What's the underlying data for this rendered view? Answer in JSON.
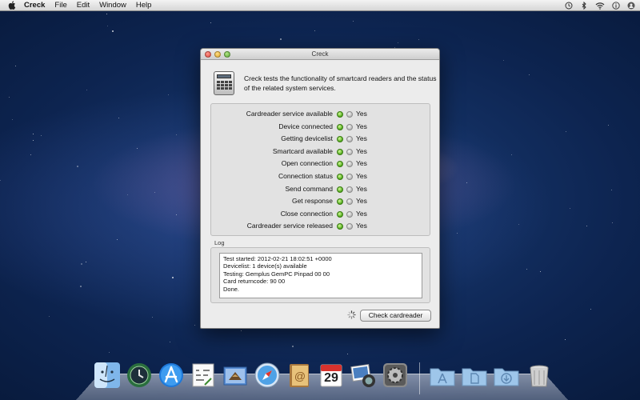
{
  "menubar": {
    "app_name": "Creck",
    "items": [
      "File",
      "Edit",
      "Window",
      "Help"
    ],
    "status_icons": [
      "time-machine-icon",
      "bluetooth-icon",
      "wifi-icon",
      "info-icon",
      "fast-user-switch-icon"
    ]
  },
  "window": {
    "title": "Creck",
    "description": "Creck tests the functionality of smartcard readers and the status of the related system services.",
    "checks": [
      {
        "label": "Cardreader service available",
        "value": "Yes",
        "status": "ok"
      },
      {
        "label": "Device connected",
        "value": "Yes",
        "status": "ok"
      },
      {
        "label": "Getting devicelist",
        "value": "Yes",
        "status": "ok"
      },
      {
        "label": "Smartcard available",
        "value": "Yes",
        "status": "ok"
      },
      {
        "label": "Open connection",
        "value": "Yes",
        "status": "ok"
      },
      {
        "label": "Connection status",
        "value": "Yes",
        "status": "ok"
      },
      {
        "label": "Send command",
        "value": "Yes",
        "status": "ok"
      },
      {
        "label": "Get response",
        "value": "Yes",
        "status": "ok"
      },
      {
        "label": "Close connection",
        "value": "Yes",
        "status": "ok"
      },
      {
        "label": "Cardreader service released",
        "value": "Yes",
        "status": "ok"
      }
    ],
    "log_label": "Log",
    "log_lines": [
      "Test started: 2012-02-21 18:02:51 +0000",
      "Devicelist: 1 device(s) available",
      "Testing: Gemplus GemPC Pinpad 00 00",
      "Card returncode: 90 00",
      "Done."
    ],
    "button_label": "Check cardreader"
  },
  "dock": {
    "apps": [
      "finder-icon",
      "time-machine-icon",
      "app-store-icon",
      "grapher-icon",
      "mail-icon",
      "safari-icon",
      "address-book-icon",
      "ical-icon",
      "photo-booth-icon",
      "system-preferences-icon"
    ],
    "calendar_day": "29",
    "folders": [
      "applications-folder-icon",
      "documents-folder-icon",
      "downloads-folder-icon"
    ],
    "trash": "trash-icon"
  },
  "colors": {
    "led_ok": "#4fa81a",
    "led_off": "#b7b7b7",
    "window_bg": "#ececec"
  }
}
